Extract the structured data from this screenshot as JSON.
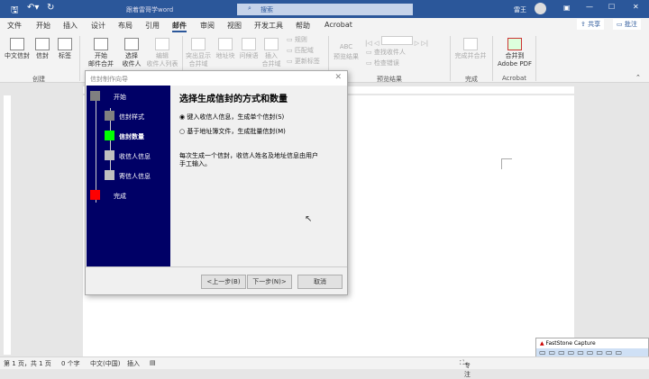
{
  "titlebar": {
    "doc_title": "跟着雷哥学word",
    "search_placeholder": "搜索",
    "user": "雷王",
    "color": "#2b579a"
  },
  "tabs": [
    "文件",
    "开始",
    "插入",
    "设计",
    "布局",
    "引用",
    "邮件",
    "审阅",
    "视图",
    "开发工具",
    "帮助",
    "Acrobat"
  ],
  "active_tab": "邮件",
  "share_label": "共享",
  "comment_label": "批注",
  "ribbon": {
    "create": {
      "label": "创建",
      "items": [
        "中文信封",
        "信封",
        "标签"
      ]
    },
    "start": {
      "items": [
        "开始\n邮件合并",
        "选择\n收件人",
        "编辑\n收件人列表"
      ]
    },
    "write": {
      "items": [
        "突出显示\n合并域",
        "地址块",
        "问候语",
        "插入\n合并域"
      ],
      "small": [
        "规则",
        "匹配域",
        "更新标签"
      ]
    },
    "preview": {
      "label": "预览结果",
      "big": "预览结果",
      "abc": "ABC",
      "small": [
        "查找收件人",
        "检查错误"
      ]
    },
    "finish": {
      "label": "完成",
      "item": "完成并合并"
    },
    "acrobat": {
      "label": "Acrobat",
      "item": "合并到\nAdobe PDF"
    }
  },
  "dialog": {
    "title": "信封制作向导",
    "steps": [
      {
        "label": "开始",
        "color": "#808080"
      },
      {
        "label": "信封样式",
        "color": "#808080"
      },
      {
        "label": "信封数量",
        "color": "#00ff00"
      },
      {
        "label": "收信人信息",
        "color": "#c0c0c0"
      },
      {
        "label": "寄信人信息",
        "color": "#c0c0c0"
      },
      {
        "label": "完成",
        "color": "#ff0000"
      }
    ],
    "heading": "选择生成信封的方式和数量",
    "options": [
      {
        "label": "键入收信人信息，生成单个信封(S)",
        "checked": true
      },
      {
        "label": "基于地址簿文件，生成批量信封(M)",
        "checked": false
      }
    ],
    "description": "每次生成一个信封，收信人姓名及地址信息由用户手工输入。",
    "buttons": {
      "prev": "<上一步(B)",
      "next": "下一步(N)>",
      "cancel": "取消"
    }
  },
  "status": {
    "page": "第 1 页，共 1 页",
    "words": "0 个字",
    "lang": "中文(中国)",
    "mode": "插入",
    "focus": "专注"
  },
  "faststone": {
    "title": "FastStone Capture"
  }
}
